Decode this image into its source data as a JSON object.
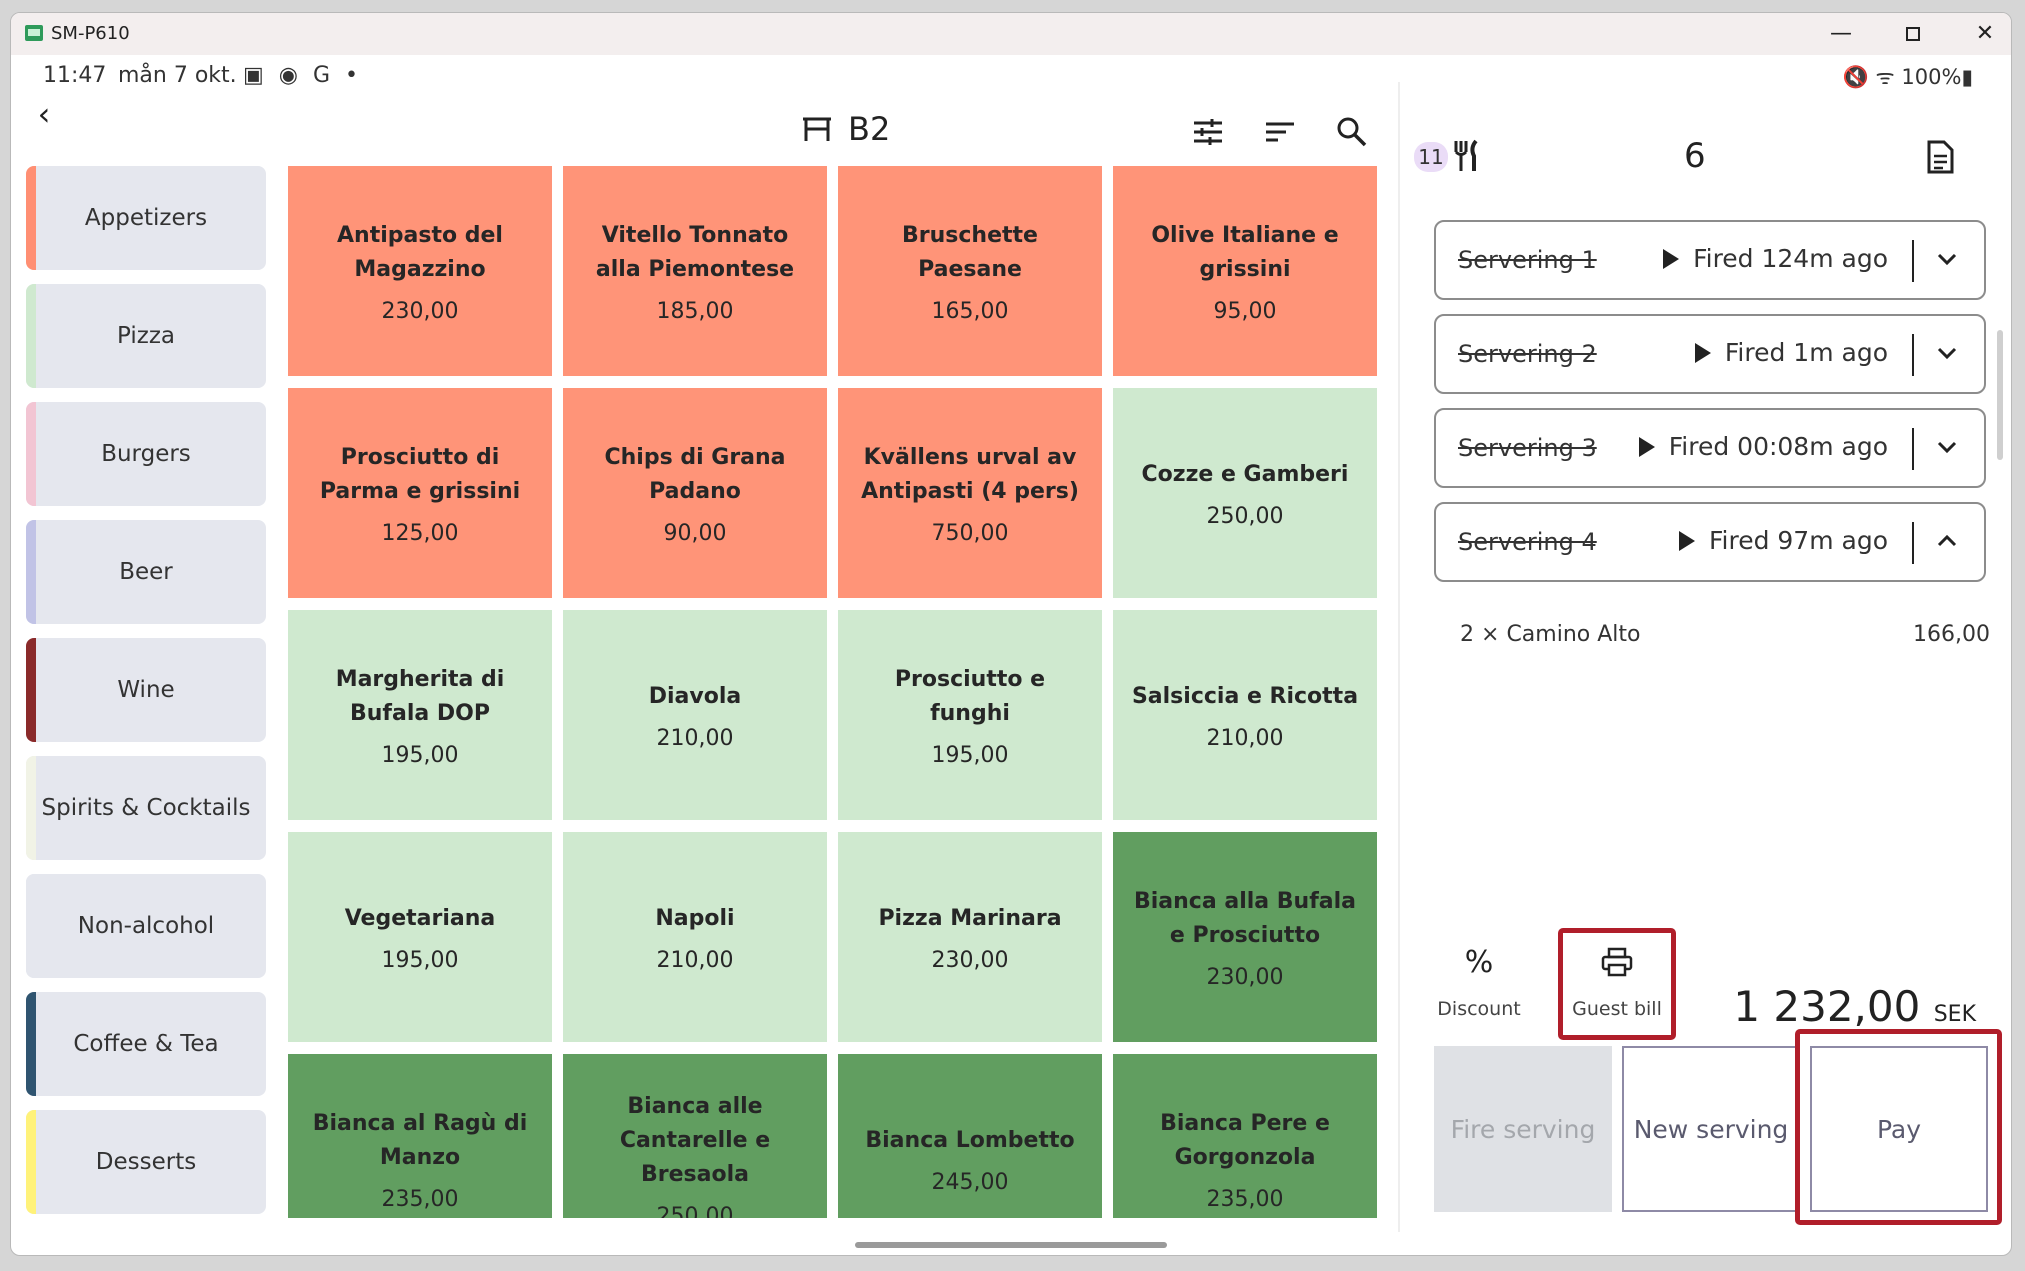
{
  "window": {
    "title": "SM-P610"
  },
  "status_bar": {
    "time": "11:47",
    "date": "mån 7 okt.",
    "notifications": "▣ ◉ G •",
    "system": "🔇 ᯤ 100%▮"
  },
  "header": {
    "table_name": "B2"
  },
  "categories": [
    {
      "label": "Appetizers",
      "color": "#ff8f73"
    },
    {
      "label": "Pizza",
      "color": "#cfe9cf"
    },
    {
      "label": "Burgers",
      "color": "#f2c5d3"
    },
    {
      "label": "Beer",
      "color": "#c1c3e6"
    },
    {
      "label": "Wine",
      "color": "#8a2a2a"
    },
    {
      "label": "Spirits & Cocktails",
      "color": "#f1f3e6"
    },
    {
      "label": "Non-alcohol",
      "color": "#e5e7ee"
    },
    {
      "label": "Coffee & Tea",
      "color": "#2f5470"
    },
    {
      "label": "Desserts",
      "color": "#fff27a"
    }
  ],
  "products": [
    {
      "name": "Antipasto del Magazzino",
      "price": "230,00",
      "color": "#ff9478"
    },
    {
      "name": "Vitello Tonnato alla Piemontese",
      "price": "185,00",
      "color": "#ff9478"
    },
    {
      "name": "Bruschette Paesane",
      "price": "165,00",
      "color": "#ff9478"
    },
    {
      "name": "Olive Italiane e grissini",
      "price": "95,00",
      "color": "#ff9478"
    },
    {
      "name": "Prosciutto di Parma e grissini",
      "price": "125,00",
      "color": "#ff9478"
    },
    {
      "name": "Chips di Grana Padano",
      "price": "90,00",
      "color": "#ff9478"
    },
    {
      "name": "Kvällens urval av Antipasti (4 pers)",
      "price": "750,00",
      "color": "#ff9478"
    },
    {
      "name": "Cozze e Gamberi",
      "price": "250,00",
      "color": "#cfe9cf"
    },
    {
      "name": "Margherita di Bufala DOP",
      "price": "195,00",
      "color": "#cfe9cf"
    },
    {
      "name": "Diavola",
      "price": "210,00",
      "color": "#cfe9cf"
    },
    {
      "name": "Prosciutto e funghi",
      "price": "195,00",
      "color": "#cfe9cf"
    },
    {
      "name": "Salsiccia e Ricotta",
      "price": "210,00",
      "color": "#cfe9cf"
    },
    {
      "name": "Vegetariana",
      "price": "195,00",
      "color": "#cfe9cf"
    },
    {
      "name": "Napoli",
      "price": "210,00",
      "color": "#cfe9cf"
    },
    {
      "name": "Pizza Marinara",
      "price": "230,00",
      "color": "#cfe9cf"
    },
    {
      "name": "Bianca alla Bufala e Prosciutto",
      "price": "230,00",
      "color": "#619e60"
    },
    {
      "name": "Bianca al Ragù di Manzo",
      "price": "235,00",
      "color": "#619e60"
    },
    {
      "name": "Bianca alle Cantarelle e Bresaola",
      "price": "250,00",
      "color": "#619e60"
    },
    {
      "name": "Bianca Lombetto",
      "price": "245,00",
      "color": "#619e60"
    },
    {
      "name": "Bianca Pere e Gorgonzola",
      "price": "235,00",
      "color": "#619e60"
    }
  ],
  "order": {
    "guests": "11",
    "seat_count": "6",
    "servings": [
      {
        "label": "Servering 1",
        "status": "Fired 124m ago",
        "expanded": false
      },
      {
        "label": "Servering 2",
        "status": "Fired 1m ago",
        "expanded": false
      },
      {
        "label": "Servering 3",
        "status": "Fired 00:08m ago",
        "expanded": false
      },
      {
        "label": "Servering 4",
        "status": "Fired 97m ago",
        "expanded": true
      }
    ],
    "line_items": [
      {
        "qty": "2 ×",
        "name": "Camino Alto",
        "price": "166,00"
      }
    ],
    "total": "1 232,00",
    "currency": "SEK"
  },
  "actions": {
    "discount_label": "Discount",
    "guest_bill_label": "Guest bill",
    "discount_icon": "%"
  },
  "buttons": {
    "fire": "Fire serving",
    "new": "New serving",
    "pay": "Pay"
  },
  "accent_highlight": "#b01e2a"
}
